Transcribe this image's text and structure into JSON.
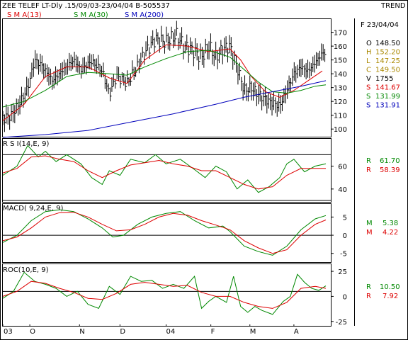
{
  "header": {
    "title": "ZEE TELEF LT-Dly .15/09/03-23/04/04  B-505537",
    "trend": "TREND",
    "sma13": "S M A(13)",
    "sma30": "S M A(30)",
    "sma200": "S M A(200)"
  },
  "colors": {
    "price": "#000000",
    "sma13": "#dd0000",
    "sma30": "#008800",
    "sma200": "#0000bb",
    "green": "#008800",
    "red": "#dd0000",
    "blue": "#0000bb",
    "frame": "#000000"
  },
  "info": {
    "date": "F 23/04/04",
    "rows": [
      {
        "k": "O",
        "v": "148.50",
        "color": "#000000"
      },
      {
        "k": "H",
        "v": "152.20",
        "color": "#aa8800"
      },
      {
        "k": "L",
        "v": "147.25",
        "color": "#aa8800"
      },
      {
        "k": "C",
        "v": "149.50",
        "color": "#aa8800"
      },
      {
        "k": "V",
        "v": "1755",
        "color": "#000000"
      },
      {
        "k": "S",
        "v": "141.67",
        "color": "#dd0000"
      },
      {
        "k": "S",
        "v": "131.99",
        "color": "#008800"
      },
      {
        "k": "S",
        "v": "131.91",
        "color": "#0000bb"
      }
    ]
  },
  "rsi_panel": {
    "title": "R S I(14,E, 9)",
    "r1": "R",
    "v1": "61.70",
    "r2": "R",
    "v2": "58.39"
  },
  "macd_panel": {
    "title": "MACD( 9,24,E, 9)",
    "r1": "M",
    "v1": "5.38",
    "r2": "M",
    "v2": "4.22"
  },
  "roc_panel": {
    "title": "ROC(10,E, 9)",
    "r1": "R",
    "v1": "10.50",
    "r2": "R",
    "v2": "7.92"
  },
  "chart_data": [
    {
      "type": "line",
      "panel": "price",
      "ylim": [
        96,
        178
      ],
      "yticks": [
        "100",
        "110",
        "120",
        "130",
        "140",
        "150",
        "160",
        "170"
      ],
      "xticks": [
        "03",
        "O",
        "N",
        "D",
        "04",
        "F",
        "M",
        "A"
      ],
      "series": [
        {
          "name": "price",
          "kind": "ohlc",
          "points": [
            [
              0,
              108
            ],
            [
              12,
              110
            ],
            [
              25,
              120
            ],
            [
              35,
              130
            ],
            [
              45,
              150
            ],
            [
              55,
              146
            ],
            [
              70,
              135
            ],
            [
              85,
              143
            ],
            [
              100,
              150
            ],
            [
              110,
              143
            ],
            [
              125,
              149
            ],
            [
              140,
              142
            ],
            [
              150,
              125
            ],
            [
              160,
              138
            ],
            [
              175,
              133
            ],
            [
              190,
              145
            ],
            [
              200,
              155
            ],
            [
              215,
              165
            ],
            [
              230,
              163
            ],
            [
              245,
              168
            ],
            [
              255,
              160
            ],
            [
              265,
              158
            ],
            [
              280,
              152
            ],
            [
              290,
              160
            ],
            [
              300,
              152
            ],
            [
              310,
              158
            ],
            [
              320,
              160
            ],
            [
              330,
              145
            ],
            [
              340,
              128
            ],
            [
              350,
              130
            ],
            [
              360,
              125
            ],
            [
              375,
              120
            ],
            [
              390,
              117
            ],
            [
              400,
              128
            ],
            [
              410,
              140
            ],
            [
              420,
              145
            ],
            [
              430,
              142
            ],
            [
              440,
              148
            ],
            [
              450,
              155
            ]
          ]
        },
        {
          "name": "S M A(13)",
          "points": [
            [
              0,
              106
            ],
            [
              30,
              118
            ],
            [
              60,
              138
            ],
            [
              90,
              145
            ],
            [
              120,
              145
            ],
            [
              150,
              137
            ],
            [
              175,
              133
            ],
            [
              200,
              150
            ],
            [
              230,
              161
            ],
            [
              260,
              160
            ],
            [
              290,
              156
            ],
            [
              320,
              158
            ],
            [
              335,
              150
            ],
            [
              350,
              138
            ],
            [
              370,
              127
            ],
            [
              390,
              123
            ],
            [
              410,
              128
            ],
            [
              430,
              135
            ],
            [
              450,
              142
            ]
          ]
        },
        {
          "name": "S M A(30)",
          "points": [
            [
              0,
              116
            ],
            [
              30,
              120
            ],
            [
              60,
              128
            ],
            [
              90,
              138
            ],
            [
              120,
              141
            ],
            [
              150,
              140
            ],
            [
              175,
              139
            ],
            [
              200,
              145
            ],
            [
              230,
              151
            ],
            [
              260,
              156
            ],
            [
              290,
              157
            ],
            [
              320,
              152
            ],
            [
              340,
              143
            ],
            [
              360,
              134
            ],
            [
              380,
              127
            ],
            [
              400,
              126
            ],
            [
              420,
              128
            ],
            [
              440,
              131
            ],
            [
              455,
              132
            ]
          ]
        },
        {
          "name": "S M A(200)",
          "points": [
            [
              0,
              94
            ],
            [
              60,
              96
            ],
            [
              120,
              99
            ],
            [
              180,
              105
            ],
            [
              240,
              111
            ],
            [
              300,
              118
            ],
            [
              340,
              123
            ],
            [
              380,
              127
            ],
            [
              420,
              131
            ],
            [
              455,
              135
            ]
          ]
        }
      ]
    },
    {
      "type": "line",
      "panel": "rsi",
      "ylim": [
        30,
        82
      ],
      "yticks": [
        "40",
        "60"
      ],
      "hlines": [
        70,
        30
      ],
      "series": [
        {
          "name": "rsi",
          "points": [
            [
              0,
              52
            ],
            [
              20,
              60
            ],
            [
              35,
              78
            ],
            [
              50,
              68
            ],
            [
              60,
              73
            ],
            [
              75,
              64
            ],
            [
              90,
              70
            ],
            [
              110,
              62
            ],
            [
              125,
              50
            ],
            [
              140,
              44
            ],
            [
              150,
              56
            ],
            [
              165,
              52
            ],
            [
              180,
              66
            ],
            [
              200,
              63
            ],
            [
              215,
              70
            ],
            [
              230,
              62
            ],
            [
              250,
              66
            ],
            [
              270,
              57
            ],
            [
              285,
              50
            ],
            [
              300,
              60
            ],
            [
              315,
              55
            ],
            [
              330,
              40
            ],
            [
              345,
              48
            ],
            [
              360,
              37
            ],
            [
              375,
              42
            ],
            [
              390,
              50
            ],
            [
              400,
              62
            ],
            [
              410,
              66
            ],
            [
              425,
              55
            ],
            [
              440,
              60
            ],
            [
              455,
              62
            ]
          ]
        },
        {
          "name": "signal",
          "points": [
            [
              0,
              54
            ],
            [
              20,
              58
            ],
            [
              40,
              68
            ],
            [
              60,
              69
            ],
            [
              80,
              66
            ],
            [
              100,
              64
            ],
            [
              120,
              56
            ],
            [
              140,
              50
            ],
            [
              160,
              56
            ],
            [
              180,
              61
            ],
            [
              200,
              63
            ],
            [
              220,
              65
            ],
            [
              240,
              62
            ],
            [
              260,
              60
            ],
            [
              280,
              56
            ],
            [
              300,
              56
            ],
            [
              320,
              50
            ],
            [
              340,
              44
            ],
            [
              360,
              40
            ],
            [
              380,
              42
            ],
            [
              400,
              52
            ],
            [
              420,
              58
            ],
            [
              440,
              58
            ],
            [
              455,
              58
            ]
          ]
        }
      ]
    },
    {
      "type": "line",
      "panel": "macd",
      "ylim": [
        -7,
        8
      ],
      "yticks": [
        "5",
        "0",
        "-5"
      ],
      "hlines": [
        0
      ],
      "series": [
        {
          "name": "macd",
          "points": [
            [
              0,
              -2
            ],
            [
              20,
              0
            ],
            [
              40,
              4
            ],
            [
              60,
              6.5
            ],
            [
              80,
              7
            ],
            [
              100,
              6.5
            ],
            [
              120,
              4.5
            ],
            [
              140,
              2
            ],
            [
              155,
              -0.5
            ],
            [
              170,
              0
            ],
            [
              190,
              3
            ],
            [
              210,
              5
            ],
            [
              230,
              6
            ],
            [
              250,
              6.5
            ],
            [
              270,
              4
            ],
            [
              290,
              2
            ],
            [
              310,
              2.5
            ],
            [
              320,
              1
            ],
            [
              340,
              -3
            ],
            [
              360,
              -4.5
            ],
            [
              380,
              -5.5
            ],
            [
              400,
              -3
            ],
            [
              420,
              1.5
            ],
            [
              440,
              4.5
            ],
            [
              455,
              5.4
            ]
          ]
        },
        {
          "name": "signal",
          "points": [
            [
              0,
              -1.5
            ],
            [
              20,
              -0.5
            ],
            [
              40,
              2
            ],
            [
              60,
              5
            ],
            [
              80,
              6.2
            ],
            [
              100,
              6.3
            ],
            [
              120,
              5
            ],
            [
              140,
              3
            ],
            [
              160,
              1.2
            ],
            [
              180,
              1.5
            ],
            [
              200,
              3
            ],
            [
              220,
              5
            ],
            [
              240,
              6
            ],
            [
              260,
              5.5
            ],
            [
              280,
              4
            ],
            [
              300,
              2.8
            ],
            [
              320,
              1.5
            ],
            [
              340,
              -1.5
            ],
            [
              360,
              -3.5
            ],
            [
              380,
              -5
            ],
            [
              400,
              -4
            ],
            [
              420,
              0
            ],
            [
              440,
              3
            ],
            [
              455,
              4.2
            ]
          ]
        }
      ]
    },
    {
      "type": "line",
      "panel": "roc",
      "ylim": [
        -28,
        30
      ],
      "yticks": [
        "25",
        "0",
        "-25"
      ],
      "hlines": [
        5
      ],
      "series": [
        {
          "name": "roc",
          "points": [
            [
              0,
              -2
            ],
            [
              15,
              5
            ],
            [
              30,
              24
            ],
            [
              45,
              15
            ],
            [
              60,
              12
            ],
            [
              75,
              8
            ],
            [
              90,
              0
            ],
            [
              105,
              5
            ],
            [
              120,
              -8
            ],
            [
              135,
              -12
            ],
            [
              150,
              10
            ],
            [
              165,
              2
            ],
            [
              180,
              20
            ],
            [
              195,
              15
            ],
            [
              210,
              16
            ],
            [
              225,
              8
            ],
            [
              240,
              12
            ],
            [
              255,
              8
            ],
            [
              270,
              20
            ],
            [
              280,
              -12
            ],
            [
              290,
              -5
            ],
            [
              300,
              0
            ],
            [
              315,
              -6
            ],
            [
              325,
              20
            ],
            [
              335,
              -10
            ],
            [
              345,
              -16
            ],
            [
              355,
              -10
            ],
            [
              365,
              -14
            ],
            [
              380,
              -18
            ],
            [
              395,
              -5
            ],
            [
              405,
              0
            ],
            [
              415,
              22
            ],
            [
              425,
              14
            ],
            [
              435,
              8
            ],
            [
              445,
              6
            ],
            [
              455,
              10.5
            ]
          ]
        },
        {
          "name": "signal",
          "points": [
            [
              0,
              0
            ],
            [
              20,
              5
            ],
            [
              40,
              15
            ],
            [
              60,
              13
            ],
            [
              80,
              8
            ],
            [
              100,
              4
            ],
            [
              120,
              -2
            ],
            [
              140,
              -3
            ],
            [
              160,
              3
            ],
            [
              180,
              12
            ],
            [
              200,
              14
            ],
            [
              220,
              12
            ],
            [
              240,
              10
            ],
            [
              260,
              11
            ],
            [
              280,
              4
            ],
            [
              300,
              0
            ],
            [
              320,
              0
            ],
            [
              340,
              -6
            ],
            [
              360,
              -10
            ],
            [
              380,
              -12
            ],
            [
              400,
              -6
            ],
            [
              420,
              8
            ],
            [
              440,
              10
            ],
            [
              455,
              8
            ]
          ]
        }
      ]
    }
  ]
}
